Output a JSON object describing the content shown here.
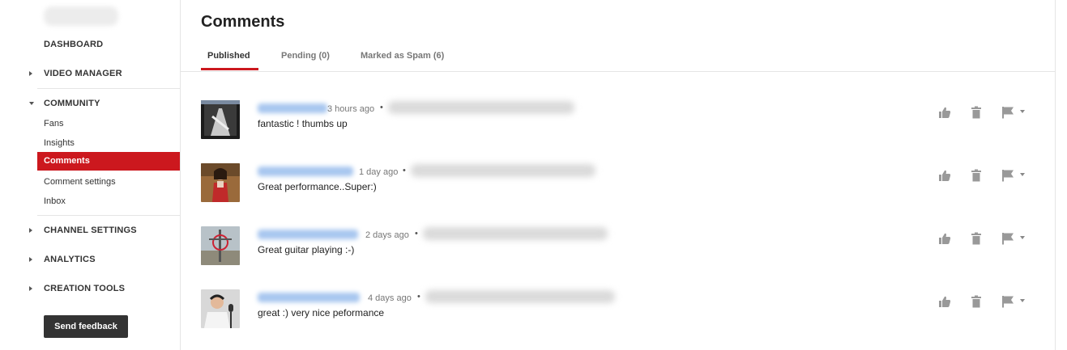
{
  "sidebar": {
    "dashboard": "DASHBOARD",
    "video_manager": "VIDEO MANAGER",
    "community": "COMMUNITY",
    "fans": "Fans",
    "insights": "Insights",
    "comments": "Comments",
    "comment_settings": "Comment settings",
    "inbox": "Inbox",
    "channel_settings": "CHANNEL SETTINGS",
    "analytics": "ANALYTICS",
    "creation_tools": "CREATION TOOLS",
    "send_feedback": "Send feedback"
  },
  "main": {
    "title": "Comments",
    "tabs": [
      {
        "label": "Published",
        "active": true
      },
      {
        "label": "Pending (0)",
        "active": false
      },
      {
        "label": "Marked as Spam (6)",
        "active": false
      }
    ]
  },
  "comments": [
    {
      "time": "3 hours ago",
      "text": "fantastic  ! thumbs up"
    },
    {
      "time": "1 day ago",
      "text": "Great performance..Super:)"
    },
    {
      "time": "2 days ago",
      "text": "Great guitar playing :-)"
    },
    {
      "time": "4 days ago",
      "text": "great :) very nice peformance"
    }
  ],
  "colors": {
    "accent": "#cc181e",
    "link_blur": "#a7c6ef",
    "icon": "#999999"
  },
  "icons": [
    "thumbs-up-icon",
    "trash-icon",
    "flag-icon",
    "caret-down-icon"
  ]
}
